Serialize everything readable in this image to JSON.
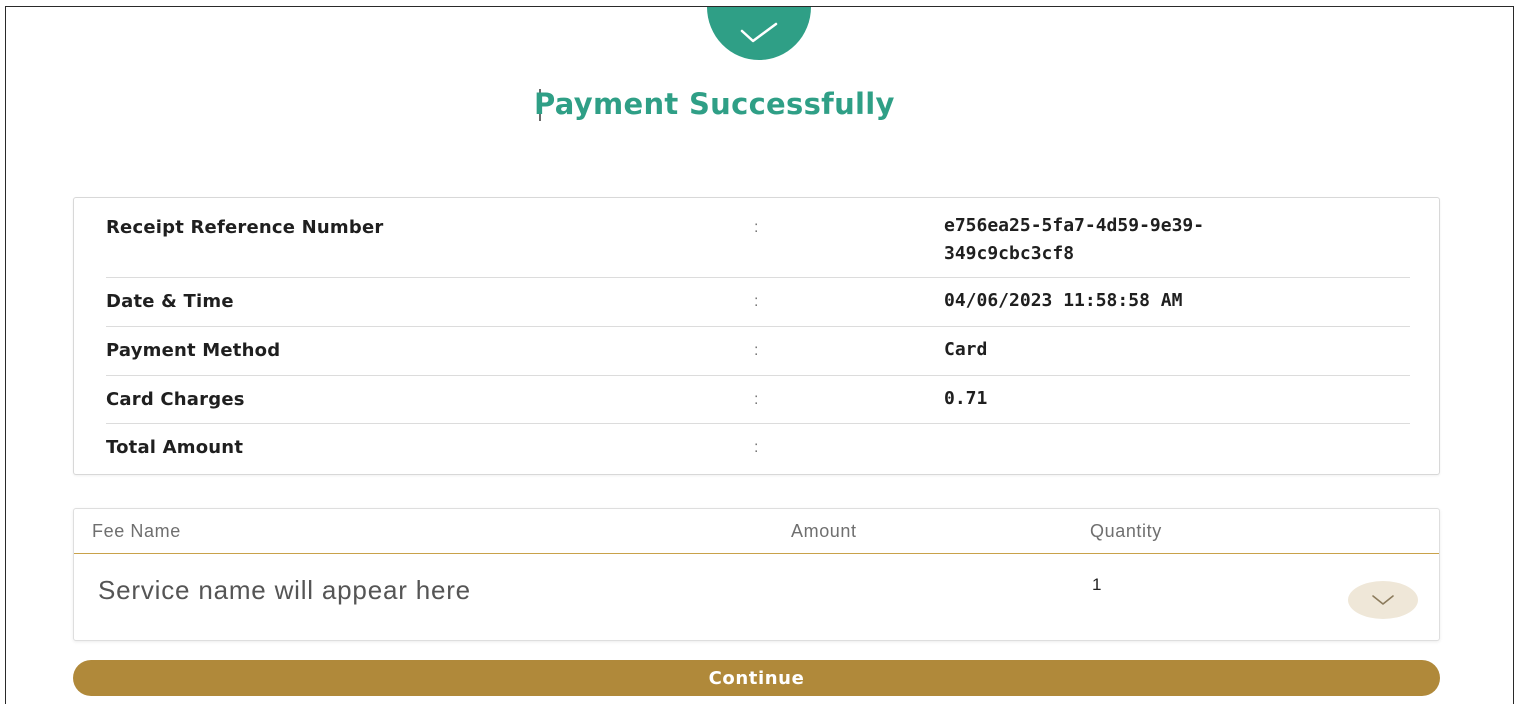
{
  "header": {
    "title": "Payment Successfully",
    "status_icon": "check-icon",
    "accent_color": "#2f9f86"
  },
  "details": {
    "separator": ":",
    "rows": [
      {
        "label": "Receipt Reference Number",
        "value": "e756ea25-5fa7-4d59-9e39-\n349c9cbc3cf8"
      },
      {
        "label": "Date & Time",
        "value": "04/06/2023 11:58:58 AM"
      },
      {
        "label": "Payment Method",
        "value": "Card"
      },
      {
        "label": "Card Charges",
        "value": "0.71"
      },
      {
        "label": "Total Amount",
        "value": ""
      }
    ]
  },
  "fees": {
    "columns": [
      "Fee Name",
      "Amount",
      "Quantity"
    ],
    "rows": [
      {
        "name": "Service name will appear here",
        "amount": "",
        "quantity": "1"
      }
    ],
    "expand_icon": "chevron-down-icon",
    "divider_color": "#c9a24a"
  },
  "actions": {
    "continue_label": "Continue",
    "button_color": "#b0893a"
  }
}
